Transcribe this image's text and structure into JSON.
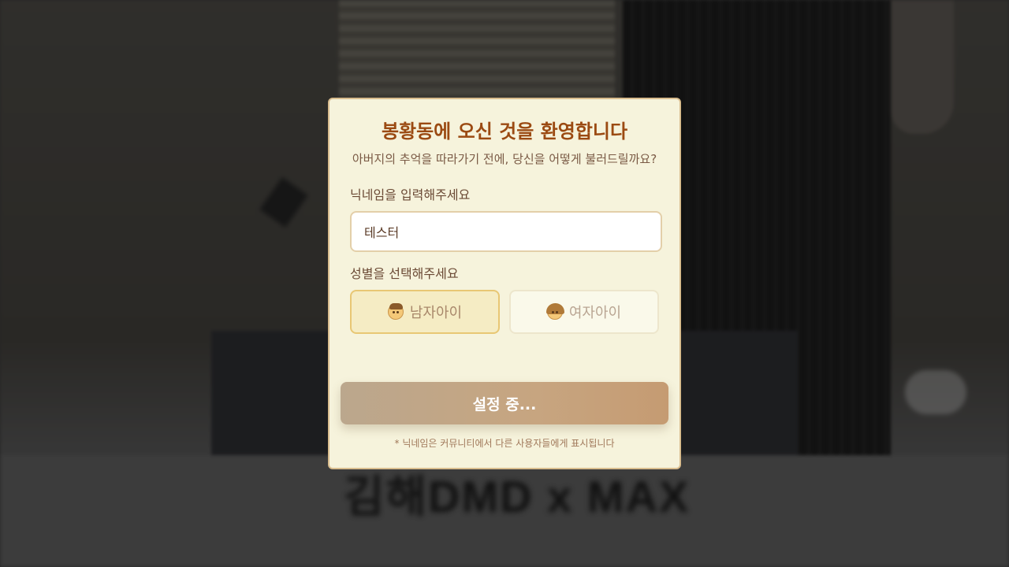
{
  "background": {
    "logo_text": "김해DMD x MAX"
  },
  "modal": {
    "title": "봉황동에 오신 것을 환영합니다",
    "subtitle": "아버지의 추억을 따라가기 전에, 당신을 어떻게 불러드릴까요?",
    "nickname": {
      "label": "닉네임을 입력해주세요",
      "value": "테스터",
      "placeholder": ""
    },
    "gender": {
      "label": "성별을 선택해주세요",
      "options": [
        {
          "label": "남자아이",
          "icon": "boy-emoji-icon",
          "selected": true
        },
        {
          "label": "여자아이",
          "icon": "girl-emoji-icon",
          "selected": false
        }
      ]
    },
    "submit_label": "설정 중...",
    "footnote": "* 닉네임은 커뮤니티에서 다른 사용자들에게 표시됩니다"
  },
  "colors": {
    "title": "#9b4a12",
    "modal_bg": "#f6f3dc",
    "modal_border": "#d9bd8e",
    "button_gradient_start": "#bba78d",
    "button_gradient_end": "#c59b72"
  }
}
